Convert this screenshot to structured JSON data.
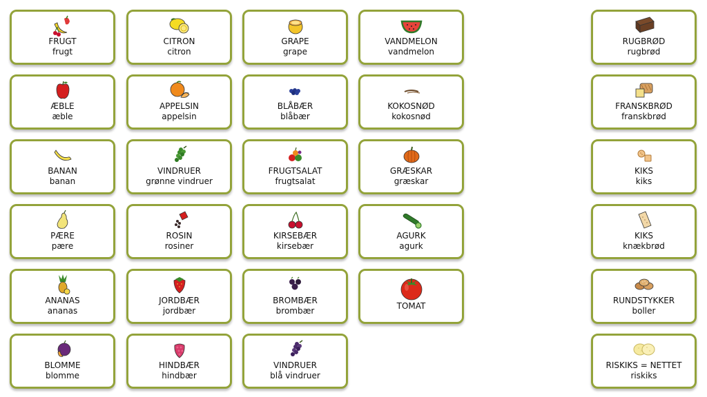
{
  "cards": {
    "frugt": {
      "title": "FRUGT",
      "sub": "frugt",
      "icon": "fruit-mix-icon"
    },
    "citron": {
      "title": "CITRON",
      "sub": "citron",
      "icon": "lemon-icon"
    },
    "grape": {
      "title": "GRAPE",
      "sub": "grape",
      "icon": "grapefruit-icon"
    },
    "vandmelon": {
      "title": "VANDMELON",
      "sub": "vandmelon",
      "icon": "watermelon-icon"
    },
    "rugbroed": {
      "title": "RUGBRØD",
      "sub": "rugbrød",
      "icon": "rye-bread-icon"
    },
    "aeble": {
      "title": "ÆBLE",
      "sub": "æble",
      "icon": "apple-icon"
    },
    "appelsin": {
      "title": "APPELSIN",
      "sub": "appelsin",
      "icon": "orange-icon"
    },
    "blaabaer": {
      "title": "BLÅBÆR",
      "sub": "blåbær",
      "icon": "blueberries-icon"
    },
    "kokosnoed": {
      "title": "KOKOSNØD",
      "sub": "kokosnød",
      "icon": "coconut-icon"
    },
    "franskbroed": {
      "title": "FRANSKBRØD",
      "sub": "franskbrød",
      "icon": "white-bread-icon"
    },
    "banan": {
      "title": "BANAN",
      "sub": "banan",
      "icon": "banana-icon"
    },
    "vindruer_g": {
      "title": "VINDRUER",
      "sub": "grønne vindruer",
      "icon": "green-grapes-icon"
    },
    "frugtsalat": {
      "title": "FRUGTSALAT",
      "sub": "frugtsalat",
      "icon": "fruit-salad-icon"
    },
    "graeskar": {
      "title": "GRÆSKAR",
      "sub": "græskar",
      "icon": "pumpkin-icon"
    },
    "kiks1": {
      "title": "KIKS",
      "sub": "kiks",
      "icon": "biscuits-icon"
    },
    "paere": {
      "title": "PÆRE",
      "sub": "pære",
      "icon": "pear-icon"
    },
    "rosin": {
      "title": "ROSIN",
      "sub": "rosiner",
      "icon": "raisins-icon"
    },
    "kirsebaer": {
      "title": "KIRSEBÆR",
      "sub": "kirsebær",
      "icon": "cherries-icon"
    },
    "agurk": {
      "title": "AGURK",
      "sub": "agurk",
      "icon": "cucumber-icon"
    },
    "kiks2": {
      "title": "KIKS",
      "sub": "knækbrød",
      "icon": "crispbread-icon"
    },
    "ananas": {
      "title": "ANANAS",
      "sub": "ananas",
      "icon": "pineapple-icon"
    },
    "jordbaer": {
      "title": "JORDBÆR",
      "sub": "jordbær",
      "icon": "strawberry-icon"
    },
    "brombaer": {
      "title": "BROMBÆR",
      "sub": "brombær",
      "icon": "blackberries-icon"
    },
    "tomat": {
      "title": "TOMAT",
      "sub": "",
      "icon": "tomato-icon"
    },
    "rundstykker": {
      "title": "RUNDSTYKKER",
      "sub": "boller",
      "icon": "bread-rolls-icon"
    },
    "blomme": {
      "title": "BLOMME",
      "sub": "blomme",
      "icon": "plum-icon"
    },
    "hindbaer": {
      "title": "HINDBÆR",
      "sub": "hindbær",
      "icon": "raspberry-icon"
    },
    "vindruer_b": {
      "title": "VINDRUER",
      "sub": "blå vindruer",
      "icon": "blue-grapes-icon"
    },
    "riskiks": {
      "title": "RISKIKS = NETTET",
      "sub": "riskiks",
      "icon": "rice-cakes-icon"
    }
  },
  "colors": {
    "border": "#93a33a",
    "background": "#ffffff",
    "text": "#111111"
  }
}
